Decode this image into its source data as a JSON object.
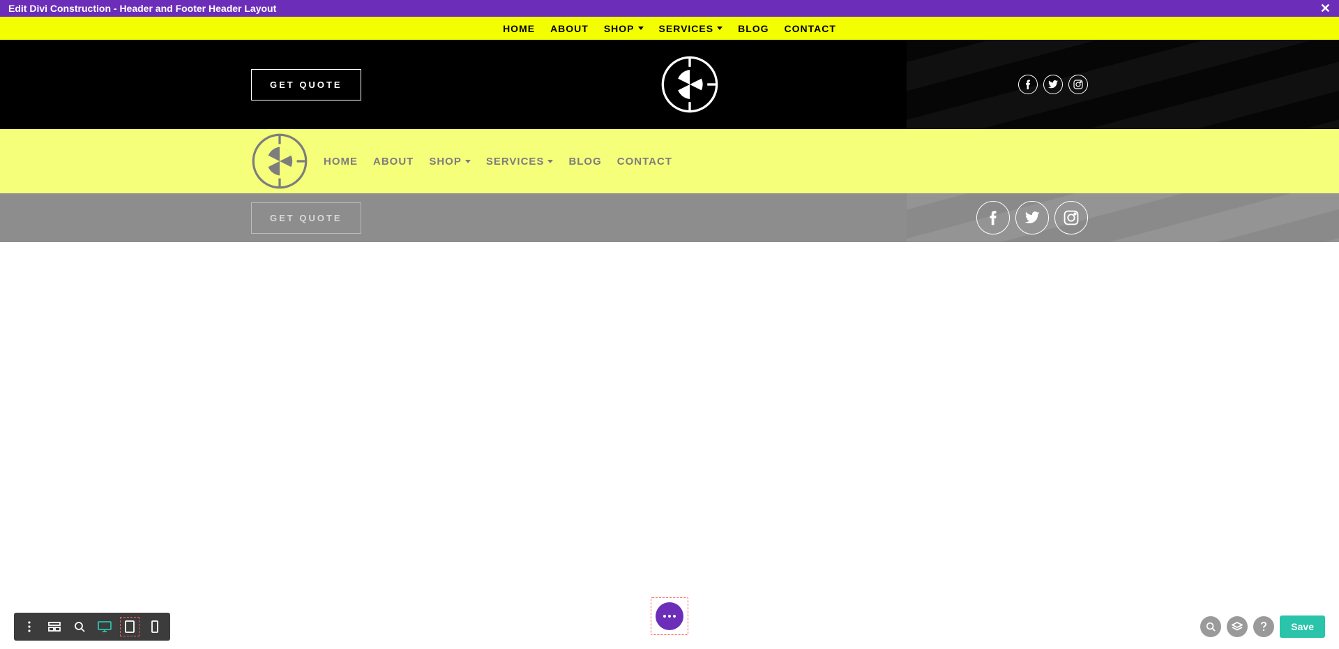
{
  "topBar": {
    "title": "Edit Divi Construction - Header and Footer Header Layout"
  },
  "navPrimary": {
    "items": [
      {
        "label": "HOME",
        "hasDropdown": false
      },
      {
        "label": "ABOUT",
        "hasDropdown": false
      },
      {
        "label": "SHOP",
        "hasDropdown": true
      },
      {
        "label": "SERVICES",
        "hasDropdown": true
      },
      {
        "label": "BLOG",
        "hasDropdown": false
      },
      {
        "label": "CONTACT",
        "hasDropdown": false
      }
    ]
  },
  "hero": {
    "quoteBtn": "GET QUOTE",
    "socials": [
      "facebook",
      "twitter",
      "instagram"
    ]
  },
  "navSecondary": {
    "items": [
      {
        "label": "HOME",
        "hasDropdown": false
      },
      {
        "label": "ABOUT",
        "hasDropdown": false
      },
      {
        "label": "SHOP",
        "hasDropdown": true
      },
      {
        "label": "SERVICES",
        "hasDropdown": true
      },
      {
        "label": "BLOG",
        "hasDropdown": false
      },
      {
        "label": "CONTACT",
        "hasDropdown": false
      }
    ]
  },
  "stripGrey": {
    "quoteBtn": "GET QUOTE",
    "socials": [
      "facebook",
      "twitter",
      "instagram"
    ]
  },
  "editor": {
    "saveLabel": "Save"
  }
}
